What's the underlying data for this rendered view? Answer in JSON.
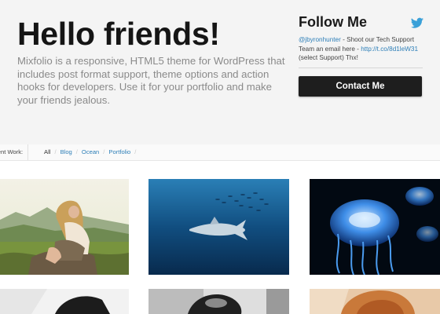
{
  "hero": {
    "title": "Hello friends!",
    "description": "Mixfolio is a responsive, HTML5 theme for WordPress that includes post format support, theme options and action hooks for developers. Use it for your portfolio and make your friends jealous."
  },
  "sidebar": {
    "title": "Follow Me",
    "icon": "twitter-bird-icon",
    "tweet": {
      "handle": "@jbyronhunter",
      "text": " - Shoot our Tech Support Team an email here - ",
      "link": "http://t.co/8d1leW31",
      "suffix": " (select Support) Thx!"
    },
    "contact_label": "Contact Me"
  },
  "filter": {
    "label": "cent Work:",
    "items": [
      {
        "label": "All",
        "active": true
      },
      {
        "label": "Blog",
        "active": false
      },
      {
        "label": "Ocean",
        "active": false
      },
      {
        "label": "Portfolio",
        "active": false
      }
    ]
  },
  "portfolio": {
    "items": [
      {
        "subject": "woman sitting on rocks with mountains"
      },
      {
        "subject": "shark swimming in blue ocean"
      },
      {
        "subject": "glowing blue jellyfish"
      },
      {
        "subject": "black and white photo"
      },
      {
        "subject": "black and white portrait"
      },
      {
        "subject": "portrait of smiling man"
      }
    ]
  },
  "colors": {
    "hero_bg": "#f4f4f4",
    "link": "#2e7fb8",
    "button_bg": "#1e1e1e",
    "twitter": "#3aa0d8"
  }
}
